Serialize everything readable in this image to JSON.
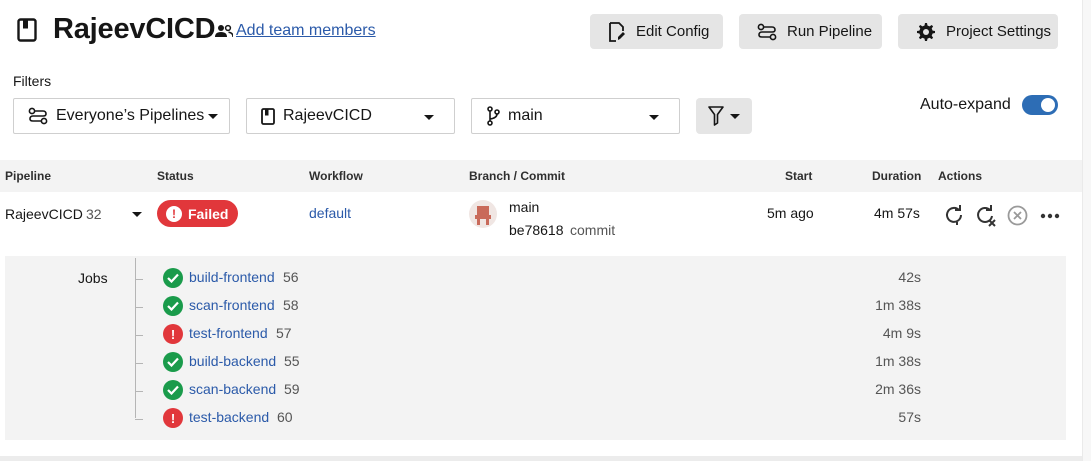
{
  "header": {
    "project_title": "RajeevCICD",
    "add_team_label": "Add team members",
    "edit_config_label": "Edit Config",
    "run_pipeline_label": "Run Pipeline",
    "project_settings_label": "Project Settings"
  },
  "filters": {
    "label": "Filters",
    "pipelines_value": "Everyone’s Pipelines",
    "project_value": "RajeevCICD",
    "branch_value": "main",
    "auto_expand_label": "Auto-expand",
    "auto_expand_on": true
  },
  "table": {
    "headers": {
      "pipeline": "Pipeline",
      "status": "Status",
      "workflow": "Workflow",
      "branch_commit": "Branch / Commit",
      "start": "Start",
      "duration": "Duration",
      "actions": "Actions"
    },
    "row": {
      "pipeline_name": "RajeevCICD",
      "pipeline_number": "32",
      "status": "Failed",
      "workflow": "default",
      "branch": "main",
      "commit_hash": "be78618",
      "commit_label": "commit",
      "start": "5m ago",
      "duration": "4m 57s"
    }
  },
  "jobs": {
    "label": "Jobs",
    "items": [
      {
        "name": "build-frontend",
        "number": "56",
        "duration": "42s",
        "status": "success"
      },
      {
        "name": "scan-frontend",
        "number": "58",
        "duration": "1m 38s",
        "status": "success"
      },
      {
        "name": "test-frontend",
        "number": "57",
        "duration": "4m 9s",
        "status": "failed"
      },
      {
        "name": "build-backend",
        "number": "55",
        "duration": "1m 38s",
        "status": "success"
      },
      {
        "name": "scan-backend",
        "number": "59",
        "duration": "2m 36s",
        "status": "success"
      },
      {
        "name": "test-backend",
        "number": "60",
        "duration": "57s",
        "status": "failed"
      }
    ]
  },
  "colors": {
    "failed": "#e1373b",
    "success": "#1a9b4b",
    "link": "#2b5aa9",
    "toggle": "#2d6db5"
  }
}
